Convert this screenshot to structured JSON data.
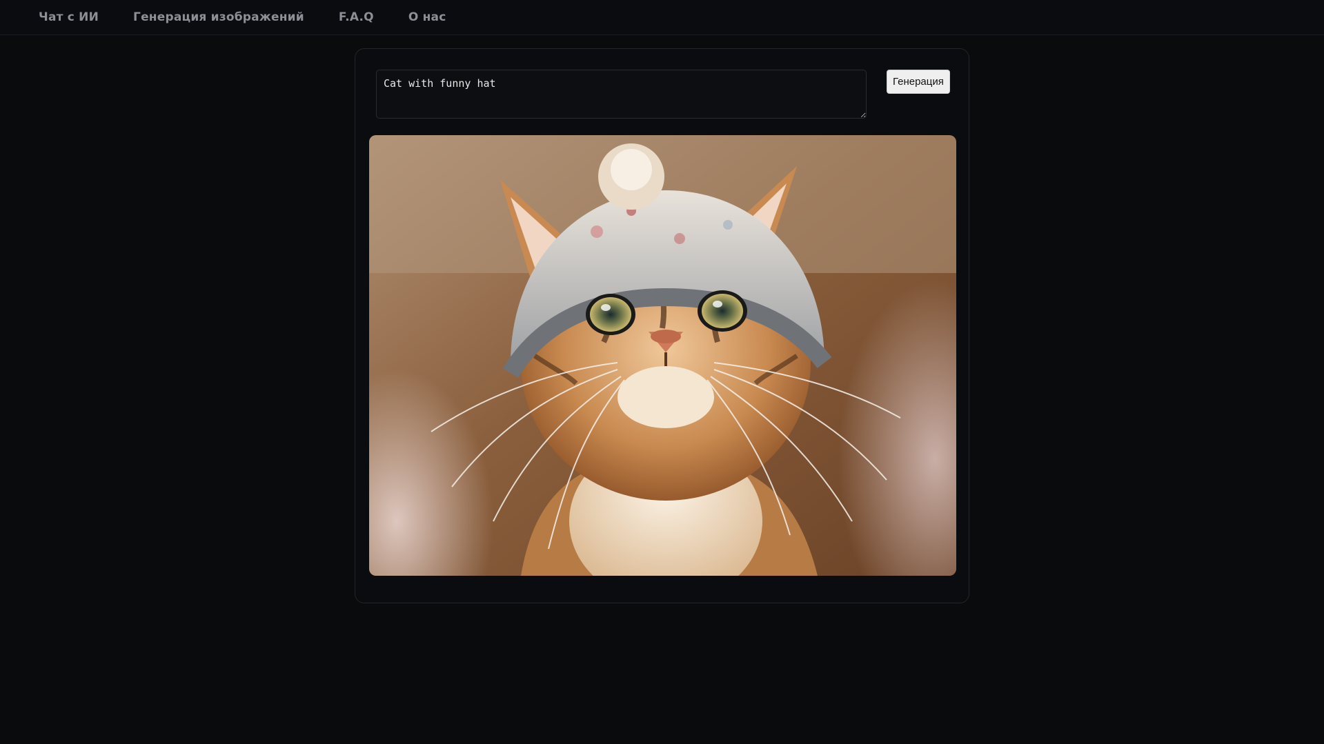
{
  "nav": {
    "items": [
      {
        "label": "Чат с ИИ"
      },
      {
        "label": "Генерация изображений"
      },
      {
        "label": "F.A.Q"
      },
      {
        "label": "О нас"
      }
    ]
  },
  "generator": {
    "prompt_value": "Cat with funny hat",
    "generate_label": "Генерация",
    "image_subject": "cat-with-knitted-hat"
  },
  "colors": {
    "background": "#0a0b0d",
    "nav_text": "#8d8f96",
    "panel_border": "#24262b",
    "button_bg": "#efefef"
  }
}
